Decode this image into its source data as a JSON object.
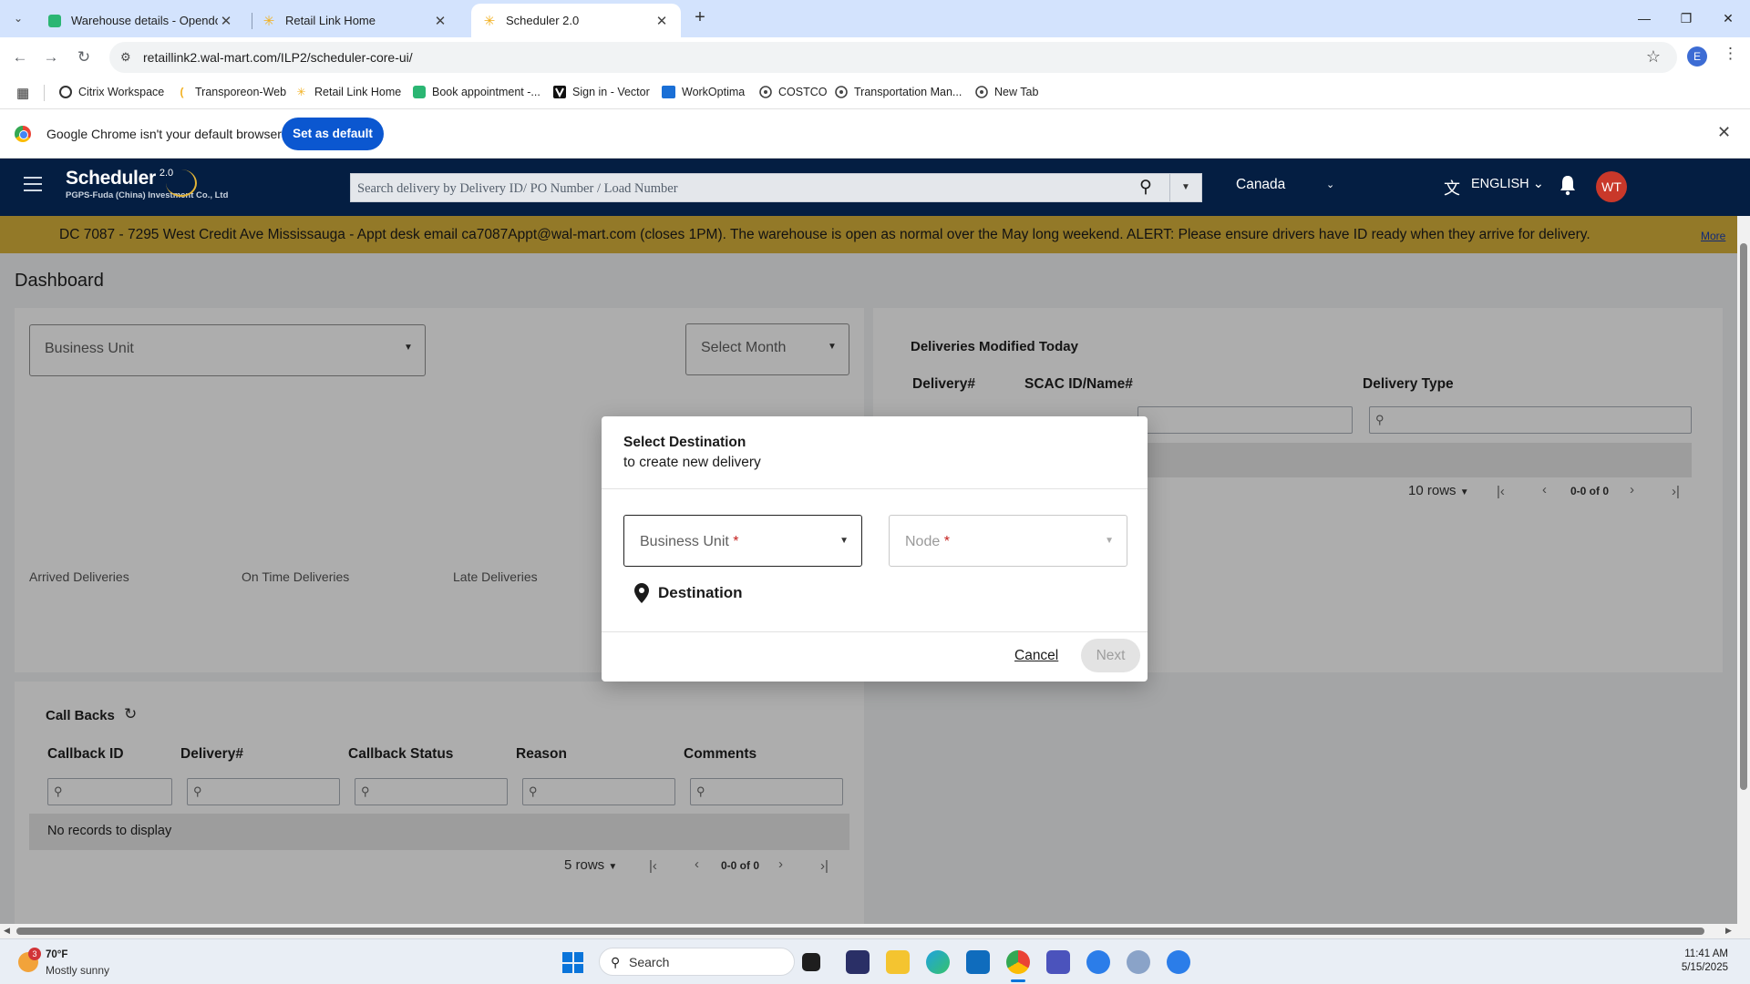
{
  "browser": {
    "tabs": [
      {
        "title": "Warehouse details - Opendock",
        "active": false
      },
      {
        "title": "Retail Link Home",
        "active": false
      },
      {
        "title": "Scheduler 2.0",
        "active": true
      }
    ],
    "url": "retaillink2.wal-mart.com/ILP2/scheduler-core-ui/",
    "profile_initial": "E",
    "bookmarks": [
      "Citrix Workspace",
      "Transporeon-Web",
      "Retail Link Home",
      "Book appointment -...",
      "Sign in - Vector",
      "WorkOptima",
      "COSTCO",
      "Transportation Man...",
      "New Tab"
    ],
    "infobar": {
      "message": "Google Chrome isn't your default browser",
      "button": "Set as default"
    }
  },
  "app": {
    "brand": {
      "name": "Scheduler",
      "version": "2.0",
      "company": "PGPS-Fuda (China) Investment Co., Ltd"
    },
    "search_placeholder": "Search delivery by Delivery ID/ PO Number / Load Number",
    "country": "Canada",
    "language": "ENGLISH",
    "user_initials": "WT",
    "alert": {
      "text": "DC 7087 - 7295 West Credit Ave Mississauga - Appt desk email ca7087Appt@wal-mart.com (closes 1PM). The warehouse is open as normal over the May long weekend. ALERT: Please ensure drivers have ID ready when they arrive for delivery.",
      "more": "More"
    },
    "colors": {
      "header": "#041e42",
      "alert": "#d9b33c",
      "avatar": "#c9382a"
    }
  },
  "dashboard": {
    "title": "Dashboard",
    "business_unit_label": "Business Unit",
    "select_month_label": "Select Month",
    "stats": [
      "Arrived Deliveries",
      "On Time Deliveries",
      "Late Deliveries"
    ],
    "modified_today": {
      "title": "Deliveries Modified Today",
      "columns": [
        "Delivery#",
        "SCAC ID/Name#",
        "Delivery Type"
      ],
      "rows_label": "10 rows",
      "page_info": "0-0 of 0"
    },
    "callbacks": {
      "title": "Call Backs",
      "columns": [
        "Callback ID",
        "Delivery#",
        "Callback Status",
        "Reason",
        "Comments"
      ],
      "empty": "No records to display",
      "rows_label": "5 rows",
      "page_info": "0-0 of 0"
    }
  },
  "modal": {
    "title": "Select Destination",
    "subtitle": "to create new delivery",
    "business_unit": "Business Unit",
    "node": "Node",
    "required_mark": "*",
    "destination_label": "Destination",
    "cancel": "Cancel",
    "next": "Next"
  },
  "taskbar": {
    "weather_temp": "70°F",
    "weather_cond": "Mostly sunny",
    "weather_badge": "3",
    "search": "Search",
    "time": "11:41 AM",
    "date": "5/15/2025"
  }
}
